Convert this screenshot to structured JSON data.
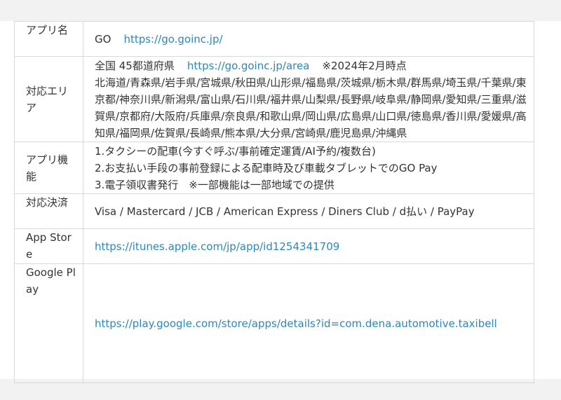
{
  "rows": {
    "app_name": {
      "label": "アプリ名",
      "name": "GO",
      "url": "https://go.goinc.jp/"
    },
    "area": {
      "label": "対応エリア",
      "summary": "全国 45都道府県",
      "url": "https://go.goinc.jp/area",
      "note": "※2024年2月時点",
      "prefectures": "北海道/青森県/岩手県/宮城県/秋田県/山形県/福島県/茨城県/栃木県/群馬県/埼玉県/千葉県/東京都/神奈川県/新潟県/富山県/石川県/福井県/山梨県/長野県/岐阜県/静岡県/愛知県/三重県/滋賀県/京都府/大阪府/兵庫県/奈良県/和歌山県/岡山県/広島県/山口県/徳島県/香川県/愛媛県/高知県/福岡県/佐賀県/長崎県/熊本県/大分県/宮崎県/鹿児島県/沖縄県"
    },
    "features": {
      "label": "アプリ機能",
      "items": [
        "1.タクシーの配車(今すぐ呼ぶ/事前確定運賃/AI予約/複数台)",
        "2.お支払い手段の事前登録による配車時及び車載タブレットでのGO Pay",
        "3.電子領収書発行　※一部機能は一部地域での提供"
      ]
    },
    "payment": {
      "label": "対応決済",
      "value": "Visa / Mastercard / JCB / American Express / Diners Club / d払い / PayPay"
    },
    "app_store": {
      "label": "App Store",
      "url": "https://itunes.apple.com/jp/app/id1254341709"
    },
    "google_play": {
      "label": "Google Play",
      "url": "https://play.google.com/store/apps/details?id=com.dena.automotive.taxibell"
    }
  }
}
